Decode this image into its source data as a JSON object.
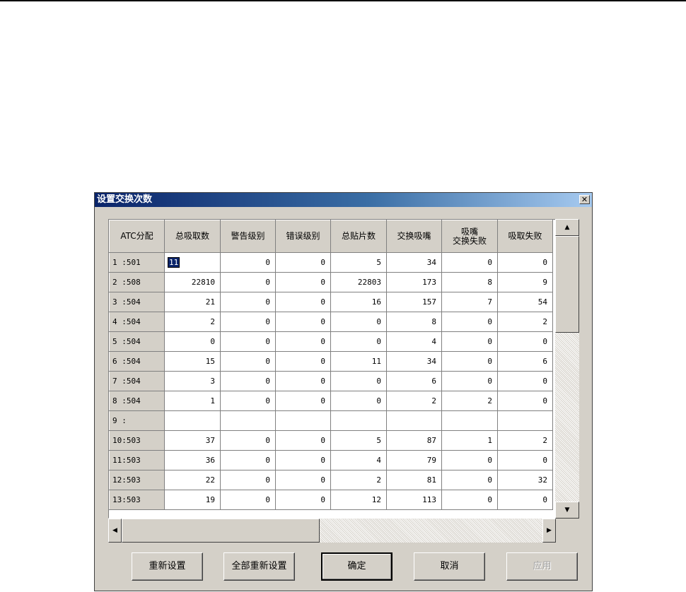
{
  "dialog": {
    "title": "设置交换次数",
    "close_glyph": "✕"
  },
  "grid": {
    "columns": [
      "ATC分配",
      "总吸取数",
      "警告级别",
      "错误级别",
      "总贴片数",
      "交换吸嘴",
      "吸嘴\n交换失败",
      "吸取失败"
    ],
    "rows": [
      [
        "1 :501",
        "11",
        "0",
        "0",
        "5",
        "34",
        "0",
        "0"
      ],
      [
        "2 :508",
        "22810",
        "0",
        "0",
        "22803",
        "173",
        "8",
        "9"
      ],
      [
        "3 :504",
        "21",
        "0",
        "0",
        "16",
        "157",
        "7",
        "54"
      ],
      [
        "4 :504",
        "2",
        "0",
        "0",
        "0",
        "8",
        "0",
        "2"
      ],
      [
        "5 :504",
        "0",
        "0",
        "0",
        "0",
        "4",
        "0",
        "0"
      ],
      [
        "6 :504",
        "15",
        "0",
        "0",
        "11",
        "34",
        "0",
        "6"
      ],
      [
        "7 :504",
        "3",
        "0",
        "0",
        "0",
        "6",
        "0",
        "0"
      ],
      [
        "8 :504",
        "1",
        "0",
        "0",
        "0",
        "2",
        "2",
        "0"
      ],
      [
        "9 :",
        "",
        "",
        "",
        "",
        "",
        "",
        ""
      ],
      [
        "10:503",
        "37",
        "0",
        "0",
        "5",
        "87",
        "1",
        "2"
      ],
      [
        "11:503",
        "36",
        "0",
        "0",
        "4",
        "79",
        "0",
        "0"
      ],
      [
        "12:503",
        "22",
        "0",
        "0",
        "2",
        "81",
        "0",
        "32"
      ],
      [
        "13:503",
        "19",
        "0",
        "0",
        "12",
        "113",
        "0",
        "0"
      ]
    ]
  },
  "scrollbar": {
    "up_arrow": "▲",
    "down_arrow": "▼",
    "left_arrow": "◀",
    "right_arrow": "▶"
  },
  "buttons": {
    "reset": "重新设置",
    "reset_all": "全部重新设置",
    "ok": "确定",
    "cancel": "取消",
    "apply": "应用"
  }
}
